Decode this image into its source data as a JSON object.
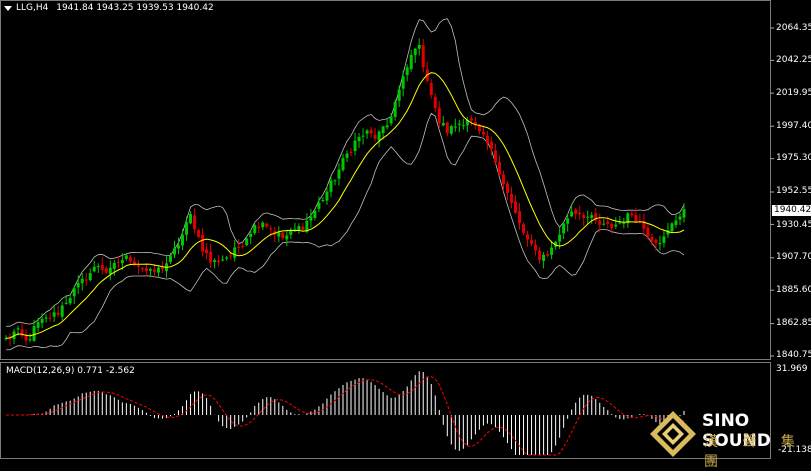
{
  "header": {
    "symbol": "LLG,H4",
    "ohlc": "1941.84 1943.25 1939.53 1940.42",
    "menu_icon": "triangle-down-icon"
  },
  "price_axis": {
    "labels": [
      "2064.35",
      "2042.25",
      "2019.95",
      "1997.40",
      "1975.30",
      "1952.55",
      "1930.45",
      "1907.70",
      "1885.60",
      "1862.85",
      "1840.75"
    ],
    "current_price": "1940.42",
    "range": [
      1840.75,
      2064.35
    ]
  },
  "macd": {
    "caption": "MACD(12,26,9) 0.771 -2.562",
    "axis_labels": [
      "31.969",
      "-21.138"
    ]
  },
  "brand": {
    "name": "SINO SOUND",
    "chinese": "漢 聲 集 團",
    "logo_icon": "diamond-logo-icon"
  },
  "colors": {
    "background": "#000000",
    "bull_candle": "#00c800",
    "bear_candle": "#e00000",
    "ma_line": "#ffff00",
    "band_line": "#bfbfbf",
    "macd_hist": "#ffffff",
    "macd_signal": "#ff0000",
    "brand_gold": "#c9a94a"
  },
  "chart_data": {
    "type": "candlestick",
    "close_path": [
      1852,
      1858,
      1850,
      1862,
      1866,
      1870,
      1880,
      1888,
      1896,
      1903,
      1897,
      1906,
      1908,
      1902,
      1897,
      1900,
      1907,
      1920,
      1937,
      1916,
      1904,
      1907,
      1910,
      1918,
      1928,
      1933,
      1926,
      1921,
      1926,
      1930,
      1939,
      1950,
      1962,
      1976,
      1987,
      1993,
      1990,
      1996,
      2016,
      2036,
      2056,
      2030,
      2002,
      1994,
      1999,
      2003,
      1993,
      1984,
      1968,
      1948,
      1930,
      1916,
      1908,
      1912,
      1926,
      1940,
      1938,
      1934,
      1929,
      1929,
      1933,
      1938,
      1929,
      1920,
      1920,
      1932,
      1941
    ]
  }
}
